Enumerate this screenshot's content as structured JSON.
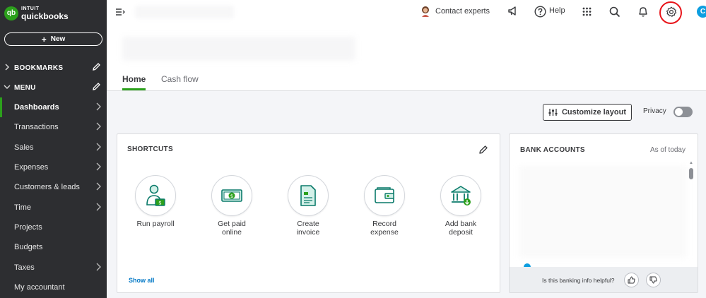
{
  "brand": {
    "logo_badge": "qb",
    "line1": "INTUIT",
    "line2": "quickbooks"
  },
  "sidebar": {
    "new_label": "New",
    "bookmarks_label": "BOOKMARKS",
    "menu_label": "MENU",
    "items": [
      {
        "label": "Dashboards"
      },
      {
        "label": "Transactions"
      },
      {
        "label": "Sales"
      },
      {
        "label": "Expenses"
      },
      {
        "label": "Customers & leads"
      },
      {
        "label": "Time"
      },
      {
        "label": "Projects"
      },
      {
        "label": "Budgets"
      },
      {
        "label": "Taxes"
      },
      {
        "label": "My accountant"
      }
    ]
  },
  "header": {
    "contact_label": "Contact experts",
    "help_label": "Help",
    "user_initial": "C"
  },
  "tabs": {
    "home": "Home",
    "cash_flow": "Cash flow"
  },
  "toolbar": {
    "customize_label": "Customize layout",
    "privacy_label": "Privacy"
  },
  "shortcuts": {
    "title": "SHORTCUTS",
    "show_all": "Show all",
    "items": [
      {
        "line1": "Run payroll",
        "line2": ""
      },
      {
        "line1": "Get paid",
        "line2": "online"
      },
      {
        "line1": "Create",
        "line2": "invoice"
      },
      {
        "line1": "Record",
        "line2": "expense"
      },
      {
        "line1": "Add bank",
        "line2": "deposit"
      }
    ]
  },
  "bank": {
    "title": "BANK ACCOUNTS",
    "as_of": "As of today",
    "helpful_prompt": "Is this banking info helpful?"
  },
  "colors": {
    "brand_green": "#2ca01c",
    "sidebar_bg": "#2d2e31",
    "highlight_red": "#e8141a",
    "link_blue": "#0077c5"
  }
}
